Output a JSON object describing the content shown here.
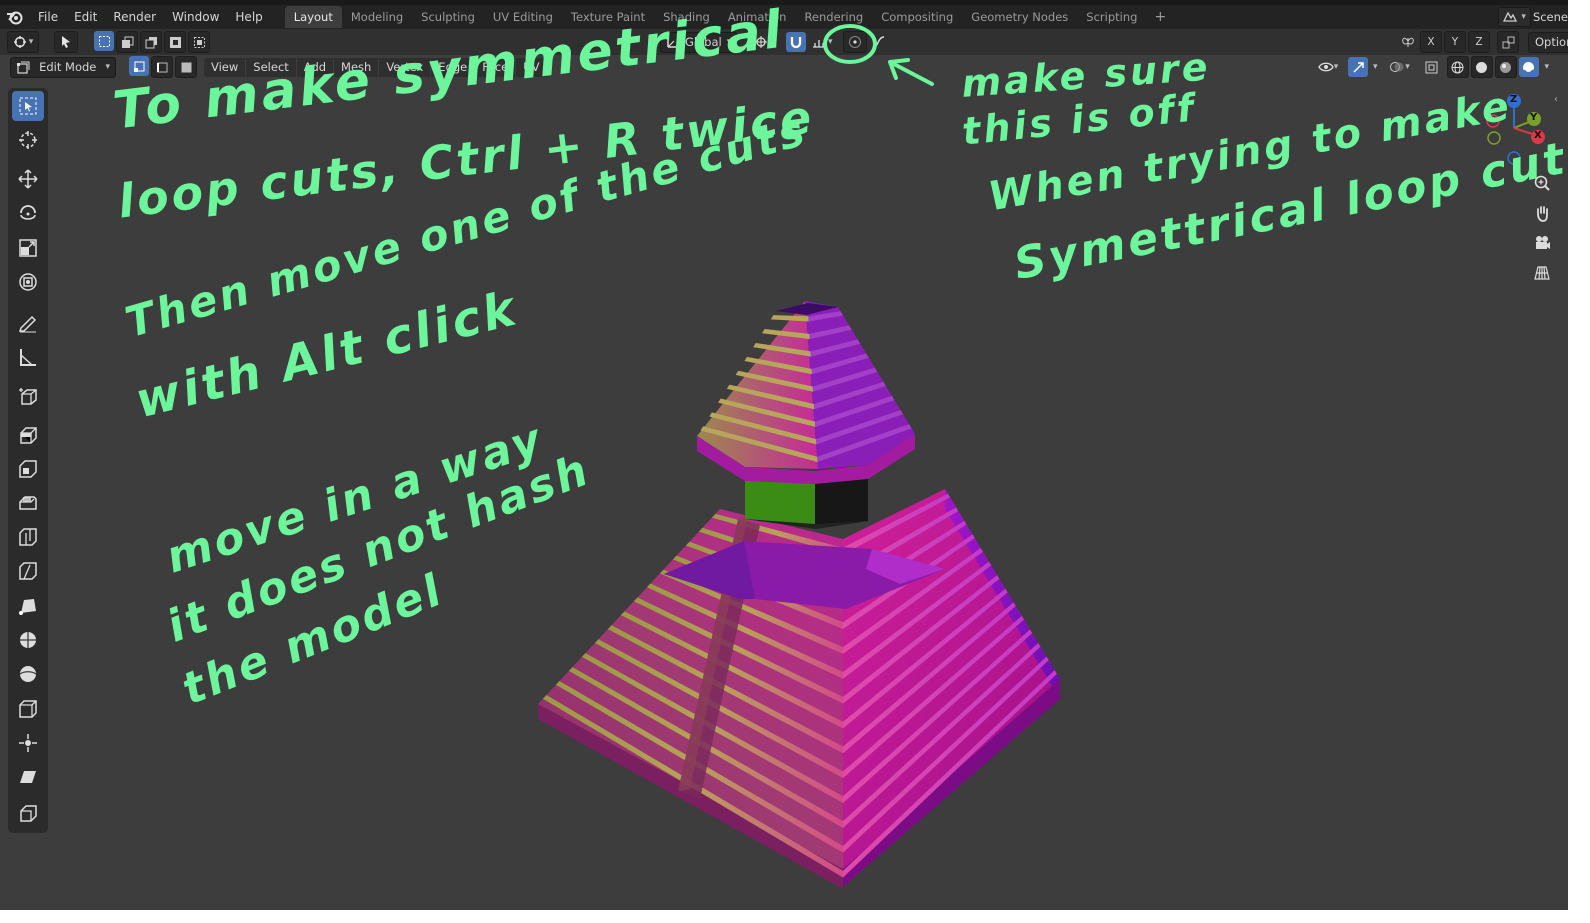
{
  "menu": {
    "items": [
      "File",
      "Edit",
      "Render",
      "Window",
      "Help"
    ]
  },
  "workspaces": {
    "tabs": [
      "Layout",
      "Modeling",
      "Sculpting",
      "UV Editing",
      "Texture Paint",
      "Shading",
      "Animation",
      "Rendering",
      "Compositing",
      "Geometry Nodes",
      "Scripting"
    ],
    "active": "Layout",
    "add_label": "+"
  },
  "scene": {
    "label": "Scene"
  },
  "tool_header": {
    "orientation": "Global",
    "axes": [
      "X",
      "Y",
      "Z"
    ],
    "options_label": "Options"
  },
  "viewport_header": {
    "mode": "Edit Mode",
    "menus": [
      "View",
      "Select",
      "Add",
      "Mesh",
      "Vertex",
      "Edge",
      "Face",
      "UV"
    ]
  },
  "gizmo": {
    "x": "X",
    "y": "Y",
    "z": "Z"
  },
  "annotations": {
    "line1": "To make symmetrical",
    "line2": "loop cuts, Ctrl + R twice",
    "line3": "Then move one of the cuts",
    "line4": "with Alt click",
    "line5": "move in a way",
    "line6": "it does not hash",
    "line7": "the model",
    "right1": "make sure",
    "right2": "this is off",
    "right3": "When trying to make",
    "right4": "Symettrical loop cuts"
  },
  "colors": {
    "accent": "#4772b3",
    "annotation": "#6cf59a",
    "viewport_bg": "#3d3d3d",
    "pyramid_magenta": "#c4178f",
    "pyramid_purple": "#8a1bd6",
    "pyramid_green": "#3e8a16"
  }
}
